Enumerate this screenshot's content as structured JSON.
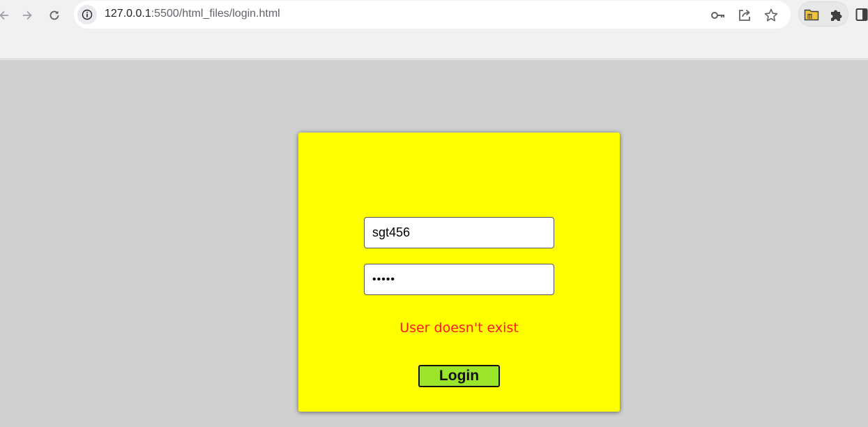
{
  "browser": {
    "url_host": "127.0.0.1",
    "url_rest": ":5500/html_files/login.html",
    "icons": {
      "back": "arrow-left-icon",
      "forward": "arrow-right-icon",
      "reload": "reload-icon",
      "site_info": "info-icon",
      "password": "key-icon",
      "share": "share-icon",
      "bookmark": "star-icon",
      "extension": "folder-extension-icon",
      "extensions_menu": "puzzle-icon",
      "side_panel": "side-panel-icon"
    }
  },
  "login_form": {
    "username_value": "sgt456",
    "password_value": "12345",
    "error_text": "User doesn't exist",
    "login_label": "Login"
  },
  "colors": {
    "page_background": "#d0d0d0",
    "card_background": "#ffff00",
    "error_color": "#ff1a1a",
    "button_background": "#9be52a"
  }
}
